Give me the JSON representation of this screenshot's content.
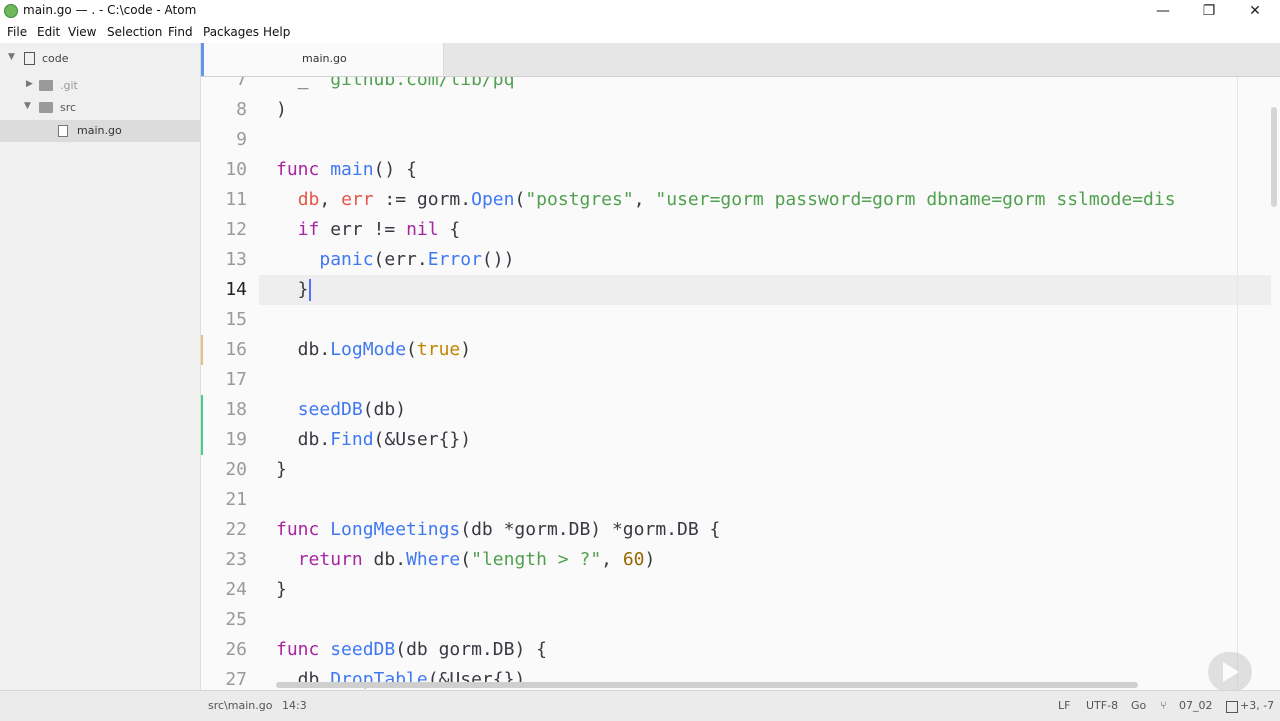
{
  "window": {
    "title": "main.go — . - C:\\code - Atom",
    "minimize": "—",
    "maximize": "❐",
    "close": "✕"
  },
  "menu": [
    "File",
    "Edit",
    "View",
    "Selection",
    "Find",
    "Packages",
    "Help"
  ],
  "tree": {
    "root": "code",
    "items": [
      {
        "label": ".git",
        "type": "folder"
      },
      {
        "label": "src",
        "type": "folder",
        "expanded": true
      },
      {
        "label": "main.go",
        "type": "file",
        "selected": true
      }
    ]
  },
  "tabs": [
    {
      "label": "main.go",
      "active": true
    }
  ],
  "editor": {
    "lines": [
      {
        "num": "7",
        "text": "  _ \"github.com/lib/pq\""
      },
      {
        "num": "8",
        "text": ")"
      },
      {
        "num": "9",
        "text": ""
      },
      {
        "num": "10",
        "text": "func main() {"
      },
      {
        "num": "11",
        "text": "  db, err := gorm.Open(\"postgres\", \"user=gorm password=gorm dbname=gorm sslmode=dis"
      },
      {
        "num": "12",
        "text": "  if err != nil {"
      },
      {
        "num": "13",
        "text": "    panic(err.Error())"
      },
      {
        "num": "14",
        "text": "  }"
      },
      {
        "num": "15",
        "text": ""
      },
      {
        "num": "16",
        "text": "  db.LogMode(true)"
      },
      {
        "num": "17",
        "text": ""
      },
      {
        "num": "18",
        "text": "  seedDB(db)"
      },
      {
        "num": "19",
        "text": "  db.Find(&User{})"
      },
      {
        "num": "20",
        "text": "}"
      },
      {
        "num": "21",
        "text": ""
      },
      {
        "num": "22",
        "text": "func LongMeetings(db *gorm.DB) *gorm.DB {"
      },
      {
        "num": "23",
        "text": "  return db.Where(\"length > ?\", 60)"
      },
      {
        "num": "24",
        "text": "}"
      },
      {
        "num": "25",
        "text": ""
      },
      {
        "num": "26",
        "text": "func seedDB(db gorm.DB) {"
      },
      {
        "num": "27",
        "text": "  db.DropTable(&User{})"
      }
    ],
    "current_line": "14",
    "modified_lines": [
      "16"
    ],
    "added_lines": [
      "18",
      "19"
    ]
  },
  "status": {
    "path": "src\\main.go",
    "cursor": "14:3",
    "line_ending": "LF",
    "encoding": "UTF-8",
    "grammar": "Go",
    "branch": "07_02",
    "git_diff": "+3, -7"
  },
  "colors": {
    "keyword": "#a626a4",
    "function": "#4078f2",
    "string": "#50a14f",
    "number": "#986801",
    "variable": "#e45649",
    "builtin": "#c18401",
    "member": "#0184bc",
    "modified_marker": "#e0c285",
    "added_marker": "#43d08a",
    "tab_accent": "#6494ed"
  }
}
